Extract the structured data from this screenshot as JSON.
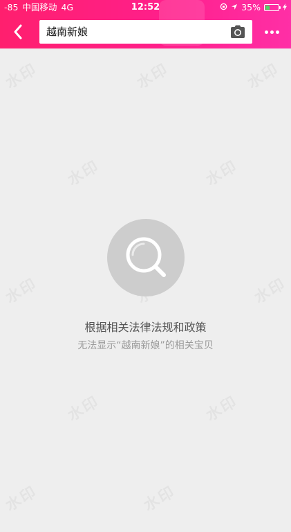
{
  "status_bar": {
    "signal": "-85",
    "carrier": "中国移动",
    "network": "4G",
    "time": "12:52",
    "battery_percent": "35%",
    "battery_level": 0.35
  },
  "nav": {
    "back_icon": "chevron-left-icon",
    "search_query": "越南新娘",
    "camera_icon": "camera-icon",
    "more_icon": "more-dots-icon"
  },
  "empty_state": {
    "icon": "search-icon",
    "title": "根据相关法律法规和政策",
    "subtitle": "无法显示“越南新娘”的相关宝贝"
  },
  "colors": {
    "topbar_start": "#ff1f6e",
    "topbar_end": "#ff2fa6",
    "background": "#eeeeee"
  }
}
